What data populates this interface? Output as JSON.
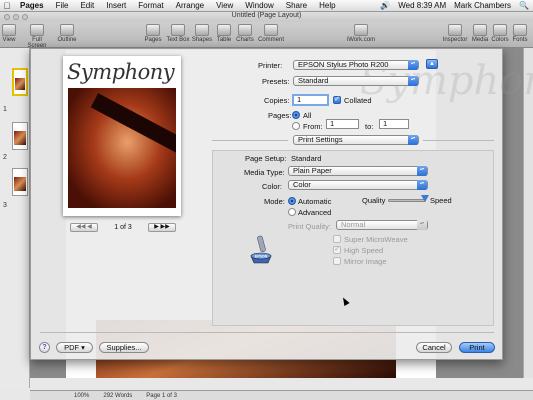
{
  "menubar": {
    "app": "Pages",
    "items": [
      "File",
      "Edit",
      "Insert",
      "Format",
      "Arrange",
      "View",
      "Window",
      "Share",
      "Help"
    ],
    "clock": "Wed 8:39 AM",
    "user": "Mark Chambers"
  },
  "window": {
    "title": "Untitled (Page Layout)",
    "toolbar": {
      "left": [
        {
          "label": "View",
          "icon": "view-icon"
        },
        {
          "label": "Full Screen",
          "icon": "fullscreen-icon"
        },
        {
          "label": "Outline",
          "icon": "outline-icon"
        }
      ],
      "center": [
        {
          "label": "Pages",
          "icon": "pages-icon"
        },
        {
          "label": "Text Box",
          "icon": "text-box-icon"
        },
        {
          "label": "Shapes",
          "icon": "shapes-icon"
        },
        {
          "label": "Table",
          "icon": "table-icon"
        },
        {
          "label": "Charts",
          "icon": "charts-icon"
        },
        {
          "label": "Comment",
          "icon": "comment-icon"
        }
      ],
      "iwork": {
        "label": "iWork.com",
        "icon": "iwork-icon"
      },
      "right": [
        {
          "label": "Inspector",
          "icon": "inspector-icon"
        },
        {
          "label": "Media",
          "icon": "media-icon"
        },
        {
          "label": "Colors",
          "icon": "colors-icon"
        },
        {
          "label": "Fonts",
          "icon": "fonts-icon"
        }
      ]
    },
    "thumbnails": [
      "1",
      "2",
      "3"
    ],
    "status": {
      "zoom": "100%",
      "words": "292 Words",
      "page": "Page 1 of 3"
    }
  },
  "print": {
    "preview": {
      "title": "Symphony",
      "page_indicator": "1 of 3"
    },
    "printer_label": "Printer:",
    "printer_value": "EPSON Stylus Photo R200",
    "presets_label": "Presets:",
    "presets_value": "Standard",
    "copies_label": "Copies:",
    "copies_value": "1",
    "collated_label": "Collated",
    "collated_checked": true,
    "pages_label": "Pages:",
    "pages_all": "All",
    "pages_from": "From:",
    "pages_from_value": "1",
    "pages_to": "to:",
    "pages_to_value": "1",
    "section_value": "Print Settings",
    "page_setup_label": "Page Setup:",
    "page_setup_value": "Standard",
    "media_type_label": "Media Type:",
    "media_type_value": "Plain Paper",
    "color_label": "Color:",
    "color_value": "Color",
    "mode_label": "Mode:",
    "mode_automatic": "Automatic",
    "mode_advanced": "Advanced",
    "quality_label": "Quality",
    "speed_label": "Speed",
    "quality_speed_level": 0.9,
    "print_quality_label": "Print Quality:",
    "print_quality_value": "Normal",
    "options": [
      {
        "label": "Super MicroWeave",
        "checked": false
      },
      {
        "label": "High Speed",
        "checked": true
      },
      {
        "label": "Mirror Image",
        "checked": false
      }
    ],
    "epson_logo": "EPSON",
    "buttons": {
      "pdf": "PDF ▾",
      "supplies": "Supplies...",
      "cancel": "Cancel",
      "print": "Print"
    },
    "accent_color": "#2f74d9"
  }
}
